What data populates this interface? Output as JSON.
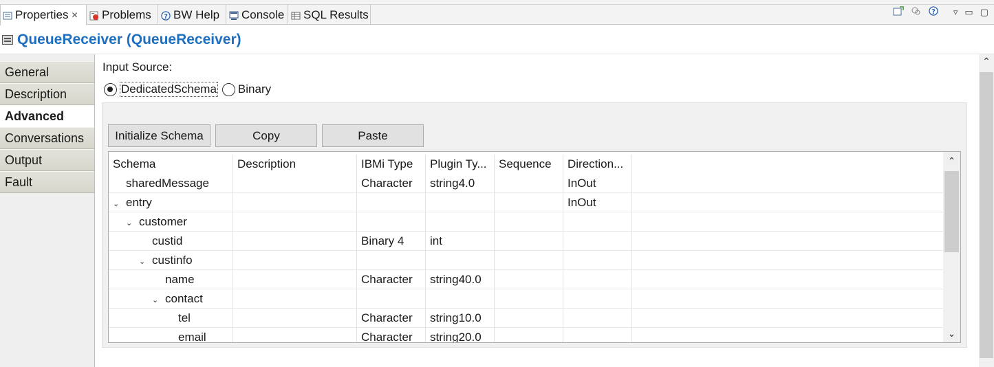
{
  "tabs": [
    {
      "label": "Properties",
      "icon": "properties-icon",
      "active": true
    },
    {
      "label": "Problems",
      "icon": "problems-icon"
    },
    {
      "label": "BW Help",
      "icon": "help-icon"
    },
    {
      "label": "Console",
      "icon": "console-icon"
    },
    {
      "label": "SQL Results",
      "icon": "sql-results-icon"
    }
  ],
  "header": {
    "title": "QueueReceiver (QueueReceiver)",
    "icon": "ibm-i-icon"
  },
  "sidebar": {
    "items": [
      {
        "label": "General"
      },
      {
        "label": "Description"
      },
      {
        "label": "Advanced",
        "active": true
      },
      {
        "label": "Conversations"
      },
      {
        "label": "Output"
      },
      {
        "label": "Fault"
      }
    ]
  },
  "main": {
    "input_source_label": "Input Source:",
    "radios": [
      {
        "label": "DedicatedSchema",
        "checked": true
      },
      {
        "label": "Binary",
        "checked": false
      }
    ],
    "buttons": {
      "initialize": "Initialize Schema",
      "copy": "Copy",
      "paste": "Paste"
    }
  },
  "table": {
    "columns": [
      "Schema",
      "Description",
      "IBMi Type",
      "Plugin Ty...",
      "Sequence",
      "Direction..."
    ],
    "rows": [
      {
        "name": "sharedMessage",
        "depth": 0,
        "expandable": false,
        "description": "",
        "ibmi_type": "Character",
        "plugin_type": "string4.0",
        "sequence": "",
        "direction": "InOut"
      },
      {
        "name": "entry",
        "depth": 0,
        "expandable": true,
        "description": "",
        "ibmi_type": "",
        "plugin_type": "",
        "sequence": "",
        "direction": "InOut"
      },
      {
        "name": "customer",
        "depth": 1,
        "expandable": true,
        "description": "",
        "ibmi_type": "",
        "plugin_type": "",
        "sequence": "",
        "direction": ""
      },
      {
        "name": "custid",
        "depth": 2,
        "expandable": false,
        "description": "",
        "ibmi_type": "Binary 4",
        "plugin_type": "int",
        "sequence": "",
        "direction": ""
      },
      {
        "name": "custinfo",
        "depth": 2,
        "expandable": true,
        "description": "",
        "ibmi_type": "",
        "plugin_type": "",
        "sequence": "",
        "direction": ""
      },
      {
        "name": "name",
        "depth": 3,
        "expandable": false,
        "description": "",
        "ibmi_type": "Character",
        "plugin_type": "string40.0",
        "sequence": "",
        "direction": ""
      },
      {
        "name": "contact",
        "depth": 3,
        "expandable": true,
        "description": "",
        "ibmi_type": "",
        "plugin_type": "",
        "sequence": "",
        "direction": ""
      },
      {
        "name": "tel",
        "depth": 4,
        "expandable": false,
        "description": "",
        "ibmi_type": "Character",
        "plugin_type": "string10.0",
        "sequence": "",
        "direction": ""
      },
      {
        "name": "email",
        "depth": 4,
        "expandable": false,
        "description": "",
        "ibmi_type": "Character",
        "plugin_type": "string20.0",
        "sequence": "",
        "direction": ""
      }
    ]
  }
}
